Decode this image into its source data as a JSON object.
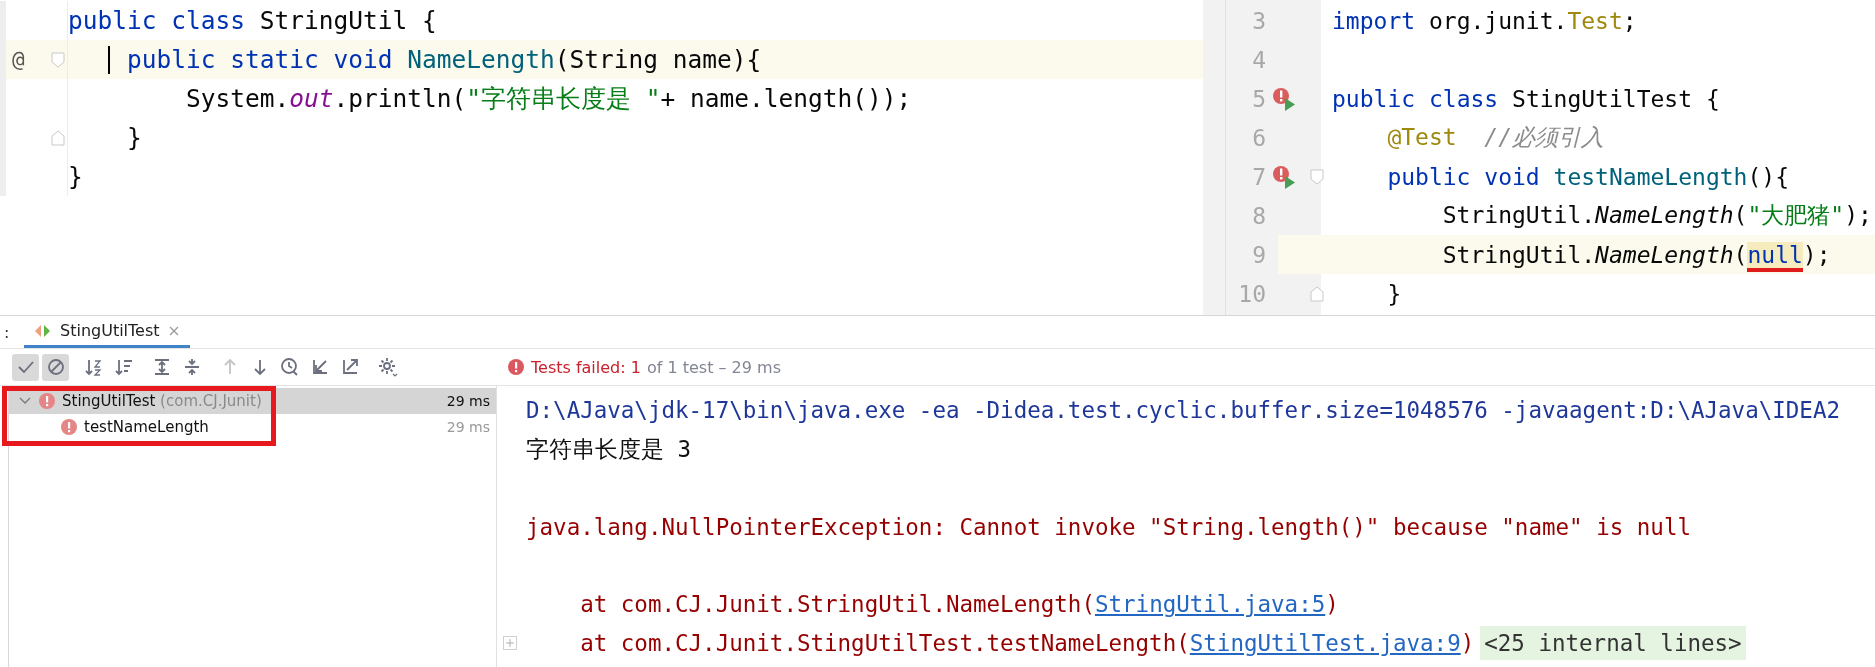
{
  "left_editor": {
    "lines": [
      {
        "current": false,
        "tokens": [
          {
            "text": "public",
            "kind": "keyword"
          },
          {
            "text": " class",
            "kind": "keyword"
          },
          {
            "text": " StringUtil {",
            "kind": "plain"
          }
        ]
      },
      {
        "marker": "@",
        "fold_start": true,
        "current": true,
        "caret": true,
        "tokens": [
          {
            "text": "    public",
            "kind": "keyword"
          },
          {
            "text": " static",
            "kind": "keyword"
          },
          {
            "text": " void",
            "kind": "keyword"
          },
          {
            "text": " NameLength",
            "kind": "method_decl"
          },
          {
            "text": "(String name){",
            "kind": "plain"
          }
        ]
      },
      {
        "current": false,
        "tokens": [
          {
            "text": "        System.",
            "kind": "plain"
          },
          {
            "text": "out",
            "kind": "static_field"
          },
          {
            "text": ".println(",
            "kind": "plain"
          },
          {
            "text": "\"字符串长度是 \"",
            "kind": "string"
          },
          {
            "text": "+ name.length());",
            "kind": "plain"
          }
        ]
      },
      {
        "current": false,
        "fold_end": true,
        "tokens": [
          {
            "text": "    }",
            "kind": "plain"
          }
        ]
      },
      {
        "current": false,
        "tokens": [
          {
            "text": "}",
            "kind": "plain"
          }
        ]
      }
    ]
  },
  "right_editor": {
    "lines": [
      {
        "number": "3",
        "current": false,
        "tokens": [
          {
            "text": "import",
            "kind": "keyword"
          },
          {
            "text": " org.junit.",
            "kind": "plain"
          },
          {
            "text": "Test",
            "kind": "annotation"
          },
          {
            "text": ";",
            "kind": "plain"
          }
        ]
      },
      {
        "number": "4",
        "current": false
      },
      {
        "number": "5",
        "current": false,
        "run_error": true,
        "tokens": [
          {
            "text": "public",
            "kind": "keyword"
          },
          {
            "text": " class",
            "kind": "keyword"
          },
          {
            "text": " StingUtilTest {",
            "kind": "plain"
          }
        ]
      },
      {
        "number": "6",
        "current": false,
        "tokens": [
          {
            "text": "    @Test",
            "kind": "annotation"
          },
          {
            "text": "  //必须引入",
            "kind": "comment"
          }
        ]
      },
      {
        "number": "7",
        "current": false,
        "run_error": true,
        "fold_start": true,
        "tokens": [
          {
            "text": "    public",
            "kind": "keyword"
          },
          {
            "text": " void",
            "kind": "keyword"
          },
          {
            "text": " testNameLength",
            "kind": "method_decl"
          },
          {
            "text": "(){",
            "kind": "plain"
          }
        ]
      },
      {
        "number": "8",
        "current": false,
        "tokens": [
          {
            "text": "        StringUtil.",
            "kind": "plain"
          },
          {
            "text": "NameLength",
            "kind": "static_call"
          },
          {
            "text": "(",
            "kind": "plain"
          },
          {
            "text": "\"大肥猪\"",
            "kind": "string"
          },
          {
            "text": ");",
            "kind": "plain"
          }
        ]
      },
      {
        "number": "9",
        "current": true,
        "tokens": [
          {
            "text": "        StringUtil.",
            "kind": "plain"
          },
          {
            "text": "NameLength",
            "kind": "static_call"
          },
          {
            "text": "(",
            "kind": "plain"
          },
          {
            "text": "null",
            "kind": "keyword",
            "highlighted": true,
            "underlined": true
          },
          {
            "text": ");",
            "kind": "plain"
          }
        ]
      },
      {
        "number": "10",
        "current": false,
        "fold_end": true,
        "tokens": [
          {
            "text": "    }",
            "kind": "plain"
          }
        ]
      }
    ]
  },
  "tool_window": {
    "cut_label": ":",
    "tabs": [
      {
        "label": "StingUtilTest",
        "selected": true
      }
    ]
  },
  "toolbar": [
    {
      "kind": "check",
      "pressed": true
    },
    {
      "kind": "stop",
      "pressed": true
    },
    {
      "kind": "sort_alpha",
      "pressed": false
    },
    {
      "kind": "sort_duration",
      "pressed": false
    },
    {
      "kind": "expand_all",
      "pressed": false
    },
    {
      "kind": "collapse_all",
      "pressed": false
    },
    {
      "kind": "up",
      "pressed": false,
      "disabled": true
    },
    {
      "kind": "down",
      "pressed": false,
      "disabled": false
    },
    {
      "kind": "history",
      "pressed": false
    },
    {
      "kind": "import",
      "pressed": false
    },
    {
      "kind": "export",
      "pressed": false
    },
    {
      "kind": "gear",
      "pressed": false
    }
  ],
  "status": {
    "failed": "Tests failed: 1",
    "summary": "of 1 test – 29 ms"
  },
  "tree": {
    "marked": true,
    "items": [
      {
        "label": "StingUtilTest",
        "package": "(com.CJ.Junit)",
        "time": "29 ms",
        "failed": true,
        "selected": true,
        "expanded": true,
        "children": [
          {
            "label": "testNameLength",
            "time": "29 ms",
            "failed": true,
            "selected": false
          }
        ]
      }
    ]
  },
  "console": [
    {
      "kind": "command",
      "text": "D:\\AJava\\jdk-17\\bin\\java.exe -ea -Didea.test.cyclic.buffer.size=1048576 -javaagent:D:\\AJava\\IDEA2"
    },
    {
      "kind": "output",
      "text": "字符串长度是 3"
    },
    {
      "kind": "blank"
    },
    {
      "kind": "error",
      "text": "java.lang.NullPointerException: Cannot invoke \"String.length()\" because \"name\" is null"
    },
    {
      "kind": "blank"
    },
    {
      "kind": "stack",
      "text": "    at com.CJ.Junit.StringUtil.NameLength(",
      "link": "StringUtil.java:5",
      "suffix": ")"
    },
    {
      "kind": "stack",
      "text": "    at com.CJ.Junit.StingUtilTest.testNameLength(",
      "link": "StingUtilTest.java:9",
      "suffix": ")",
      "folded": "<25 internal lines>"
    }
  ]
}
